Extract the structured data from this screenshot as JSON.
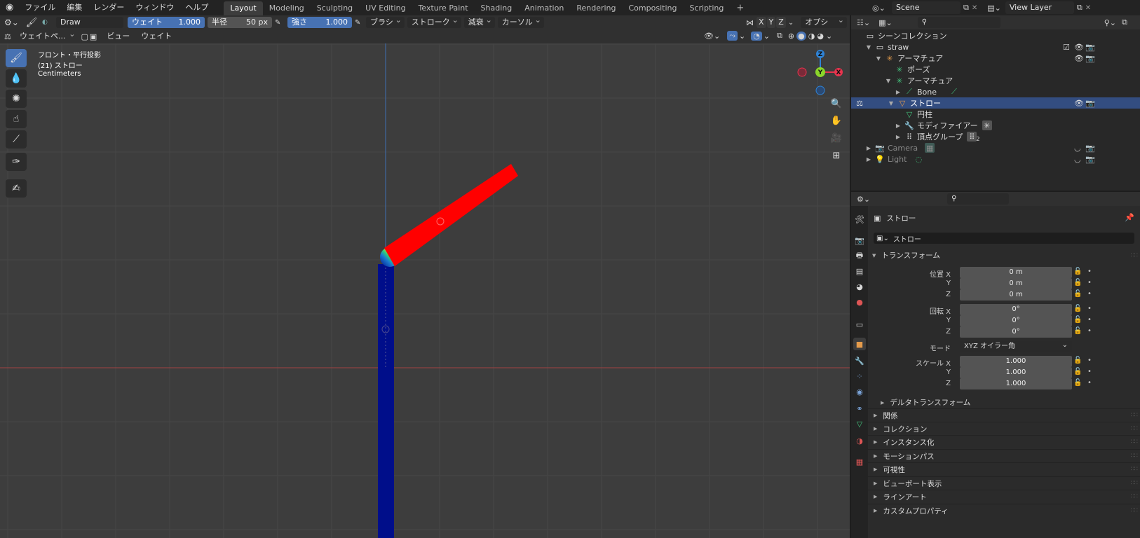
{
  "topbar": {
    "menus": [
      "ファイル",
      "編集",
      "レンダー",
      "ウィンドウ",
      "ヘルプ"
    ],
    "workspaces": [
      "Layout",
      "Modeling",
      "Sculpting",
      "UV Editing",
      "Texture Paint",
      "Shading",
      "Animation",
      "Rendering",
      "Compositing",
      "Scripting"
    ],
    "add_tab": "+",
    "scene": "Scene",
    "view_layer": "View Layer"
  },
  "toolhdr": {
    "brush_name": "Draw",
    "weight_label": "ウェイト",
    "weight_value": "1.000",
    "radius_label": "半径",
    "radius_value": "50 px",
    "strength_label": "強さ",
    "strength_value": "1.000",
    "brush_menu": "ブラシ",
    "stroke_menu": "ストローク",
    "falloff_menu": "減衰",
    "cursor_menu": "カーソル",
    "axis_x": "X",
    "axis_y": "Y",
    "axis_z": "Z",
    "options": "オプション"
  },
  "vphdr": {
    "mode": "ウェイトペ...",
    "view": "ビュー",
    "weights": "ウェイト"
  },
  "viewport": {
    "view_name": "フロント・平行投影",
    "object_info": "(21) ストロー",
    "units": "Centimeters",
    "gizmo": {
      "x": "X",
      "y": "Y",
      "z": "Z"
    },
    "colors": {
      "x_axis": "#e8344e",
      "y_axis": "#8bd62a",
      "z_axis": "#2f83d6",
      "grid_x_line": "#a34444",
      "grid_z_line": "#3f6fb2",
      "bone_low": "#000e8a",
      "bone_high": "#ff0000"
    }
  },
  "outliner": {
    "search_placeholder": "",
    "items": [
      {
        "label": "シーンコレクション"
      },
      {
        "label": "straw"
      },
      {
        "label": "アーマチュア"
      },
      {
        "label": "ポーズ"
      },
      {
        "label": "アーマチュア"
      },
      {
        "label": "Bone"
      },
      {
        "label": "ストロー"
      },
      {
        "label": "円柱"
      },
      {
        "label": "モディファイアー"
      },
      {
        "label": "頂点グループ"
      },
      {
        "label": "Camera"
      },
      {
        "label": "Light"
      }
    ],
    "vgroup_count": "2"
  },
  "props": {
    "object_name_header": "ストロー",
    "object_name_field": "ストロー",
    "transform_title": "トランスフォーム",
    "location_x_label": "位置 X",
    "y_label": "Y",
    "z_label": "Z",
    "location": [
      "0 m",
      "0 m",
      "0 m"
    ],
    "rotation_x_label": "回転 X",
    "rotation": [
      "0°",
      "0°",
      "0°"
    ],
    "mode_label": "モード",
    "mode_value": "XYZ オイラー角",
    "scale_x_label": "スケール X",
    "scale": [
      "1.000",
      "1.000",
      "1.000"
    ],
    "delta_transform": "デルタトランスフォーム",
    "sections": [
      "関係",
      "コレクション",
      "インスタンス化",
      "モーションパス",
      "可視性",
      "ビューポート表示",
      "ラインアート",
      "カスタムプロパティ"
    ]
  }
}
